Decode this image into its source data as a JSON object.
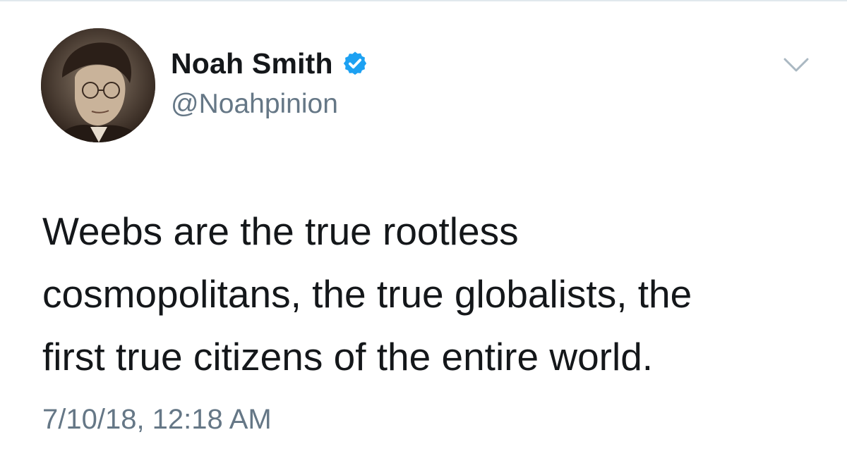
{
  "tweet": {
    "author": {
      "display_name": "Noah Smith",
      "handle": "@Noahpinion",
      "verified": true
    },
    "text_lines": [
      "Weebs are the true rootless",
      "cosmopolitans, the true globalists, the",
      "first true citizens of the entire world."
    ],
    "timestamp": "7/10/18, 12:18 AM"
  },
  "icons": {
    "verified": "verified-badge-icon",
    "caret": "chevron-down-icon"
  },
  "colors": {
    "verified_blue": "#1da1f2",
    "secondary_text": "#657786",
    "primary_text": "#14171a",
    "divider": "#e1e8ed"
  }
}
